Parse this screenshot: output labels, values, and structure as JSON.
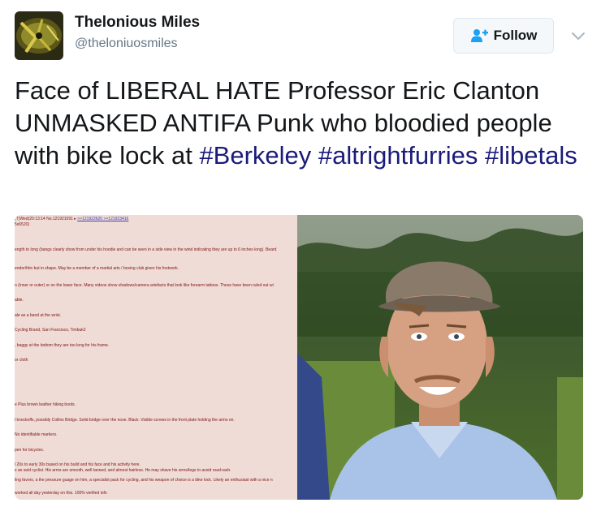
{
  "account": {
    "name": "Thelonious Miles",
    "handle": "@theloniuosmiles"
  },
  "follow": {
    "label": "Follow"
  },
  "tweet": {
    "text_1": "Face of LIBERAL HATE Professor Eric Clanton UNMASKED ANTIFA Punk who bloodied people with bike lock at ",
    "hashtag_1": "#Berkeley",
    "hashtag_2": "#altrightfurries",
    "hashtag_3": "#libetals"
  },
  "document": {
    "header": "(T)Wed)20:13:14 No.121921091 ▸",
    "header_links": ">>121922620 >>121923416",
    "header_2": "5x6520)",
    "lines": [
      "ength to long (bangs clearly show from under his hoodie and can be seen in a side view in the wind indicating they are up to 6 inches long). Beard",
      "ender/thin but in shape. May be a member of a martial arts / boxing club given his footwork.",
      "n (inner or outer) or on the lower face. Many videos show shadows/camera artefacts that look like forearm tattoos. These have been ruled out wi",
      "able.",
      "ale as a band at the wrist.",
      "Cycling Brand, San Francisco, Timbuk2",
      ", baggy at the bottom they are too long for his frame.",
      "or cloth",
      "e Plus brown leather hiking boots.",
      "l knockoffs, possibly Collins Bridge. Solid bridge over the nose. Black. Visible screws in the front plate holding the arms on.",
      "No identifiable markers.",
      "pen for bicycles.",
      "l 20s to early 30s based on his build and his face and his activity here.",
      "s an avid cyclist. His arms are smooth, well tanned, and almost hairless. He may shave his arms/legs to avoid road-rash.",
      "ling favors, a the pressure guage on him, a specialist pack for cycling, and his weapon of choice is a bike lock. Likely an enthusiast with a nice n",
      "worked all day yesterday on this. 100% verified info"
    ]
  },
  "colors": {
    "hashtag": "#1b1b7a",
    "handle": "#657786",
    "follow_icon": "#1da1f2",
    "doc_background": "#f0dcd6",
    "doc_text": "#7b1111"
  },
  "icons": {
    "follow": "add-person-icon",
    "menu": "chevron-down-icon"
  }
}
